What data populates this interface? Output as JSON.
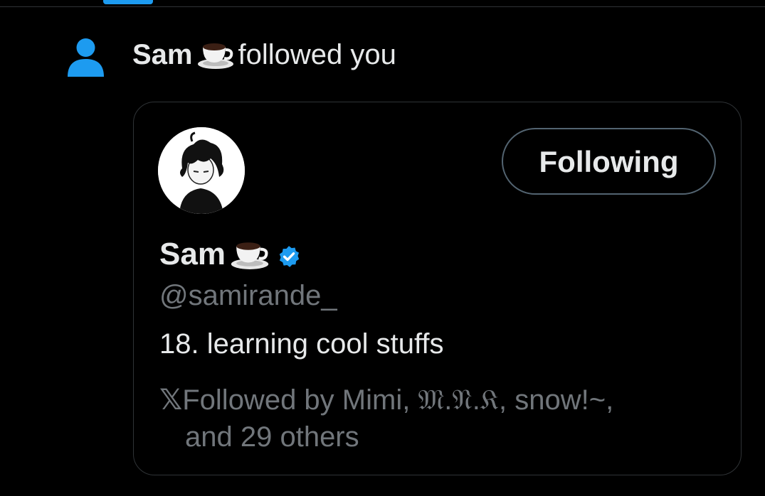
{
  "notification": {
    "actor_name": "Sam",
    "actor_emoji": "coffee-cup-icon",
    "action_text": "followed you",
    "accent_color": "#1d9bf0"
  },
  "profile_card": {
    "display_name": "Sam",
    "name_emoji": "coffee-cup-icon",
    "verified": true,
    "handle": "@samirande_",
    "bio": "18. learning cool stuffs",
    "follow_button_label": "Following",
    "followed_by_icon": "x-logo-icon",
    "followed_by_line1": "Followed by Mimi, 𝔐.𝔑.𝔎, snow!~,",
    "followed_by_line2": "and 29 others"
  }
}
